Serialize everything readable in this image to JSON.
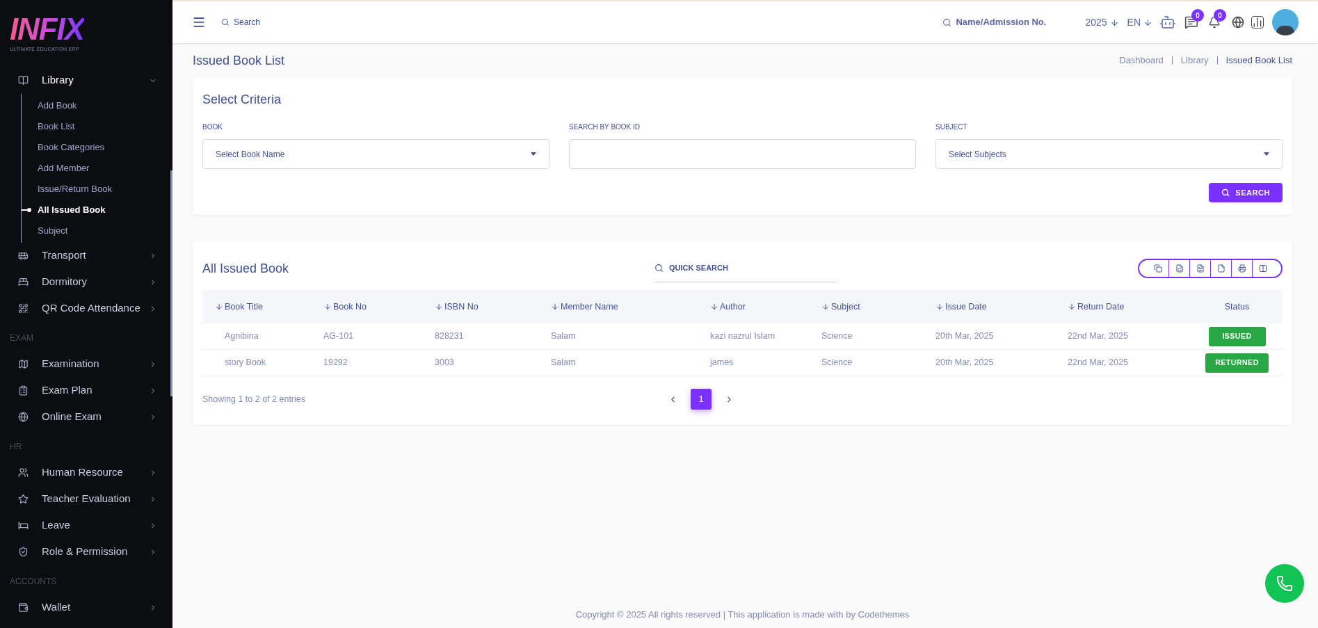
{
  "logo": {
    "title": "INFIX",
    "subtitle": "ULTIMATE EDUCATION ERP"
  },
  "sidebar": {
    "sections": [
      {
        "items": [
          {
            "label": "Library",
            "expanded": true,
            "children": [
              {
                "label": "Add Book",
                "selected": false
              },
              {
                "label": "Book List",
                "selected": false
              },
              {
                "label": "Book Categories",
                "selected": false
              },
              {
                "label": "Add Member",
                "selected": false
              },
              {
                "label": "Issue/Return Book",
                "selected": false
              },
              {
                "label": "All Issued Book",
                "selected": true
              },
              {
                "label": "Subject",
                "selected": false
              }
            ]
          },
          {
            "label": "Transport",
            "expanded": false
          },
          {
            "label": "Dormitory",
            "expanded": false
          },
          {
            "label": "QR Code Attendance",
            "expanded": false
          }
        ]
      },
      {
        "label": "EXAM",
        "items": [
          {
            "label": "Examination",
            "expanded": false
          },
          {
            "label": "Exam Plan",
            "expanded": false
          },
          {
            "label": "Online Exam",
            "expanded": false
          }
        ]
      },
      {
        "label": "HR",
        "items": [
          {
            "label": "Human Resource",
            "expanded": false
          },
          {
            "label": "Teacher Evaluation",
            "expanded": false
          },
          {
            "label": "Leave",
            "expanded": false
          },
          {
            "label": "Role & Permission",
            "expanded": false
          }
        ]
      },
      {
        "label": "ACCOUNTS",
        "items": [
          {
            "label": "Wallet",
            "expanded": false
          }
        ]
      }
    ]
  },
  "header": {
    "search": {
      "placeholder": "Search"
    },
    "student_search": {
      "placeholder": "Name/Admission No."
    },
    "year": "2025",
    "language": "EN",
    "message_count": "0",
    "notification_count": "0"
  },
  "page": {
    "title": "Issued Book List",
    "breadcrumb": [
      "Dashboard",
      "Library",
      "Issued Book List"
    ]
  },
  "criteria": {
    "title": "Select Criteria",
    "book": {
      "label": "BOOK",
      "placeholder": "Select Book Name"
    },
    "book_id": {
      "label": "SEARCH BY BOOK ID"
    },
    "subject": {
      "label": "SUBJECT",
      "placeholder": "Select Subjects"
    },
    "button": "SEARCH"
  },
  "table": {
    "title": "All Issued Book",
    "quick_search": {
      "placeholder": "QUICK SEARCH"
    },
    "columns": [
      {
        "label": "Book Title",
        "sortable": true
      },
      {
        "label": "Book No",
        "sortable": true
      },
      {
        "label": "ISBN No",
        "sortable": true
      },
      {
        "label": "Member Name",
        "sortable": true
      },
      {
        "label": "Author",
        "sortable": true
      },
      {
        "label": "Subject",
        "sortable": true
      },
      {
        "label": "Issue Date",
        "sortable": true
      },
      {
        "label": "Return Date",
        "sortable": true
      },
      {
        "label": "Status",
        "sortable": false
      }
    ],
    "rows": [
      {
        "cells": [
          "Agnibina",
          "AG-101",
          "828231",
          "Salam",
          "kazi nazrul Islam",
          "Science",
          "20th Mar, 2025",
          "22nd Mar, 2025"
        ],
        "status": "ISSUED"
      },
      {
        "cells": [
          "story Book",
          "19292",
          "3003",
          "Salam",
          "james",
          "Science",
          "20th Mar, 2025",
          "22nd Mar, 2025"
        ],
        "status": "RETURNED"
      }
    ],
    "info": "Showing 1 to 2 of 2 entries",
    "pages": [
      {
        "label": "1",
        "selected": true
      }
    ]
  },
  "footer": "Copyright © 2025 All rights reserved | This application is made with by Codethemes"
}
